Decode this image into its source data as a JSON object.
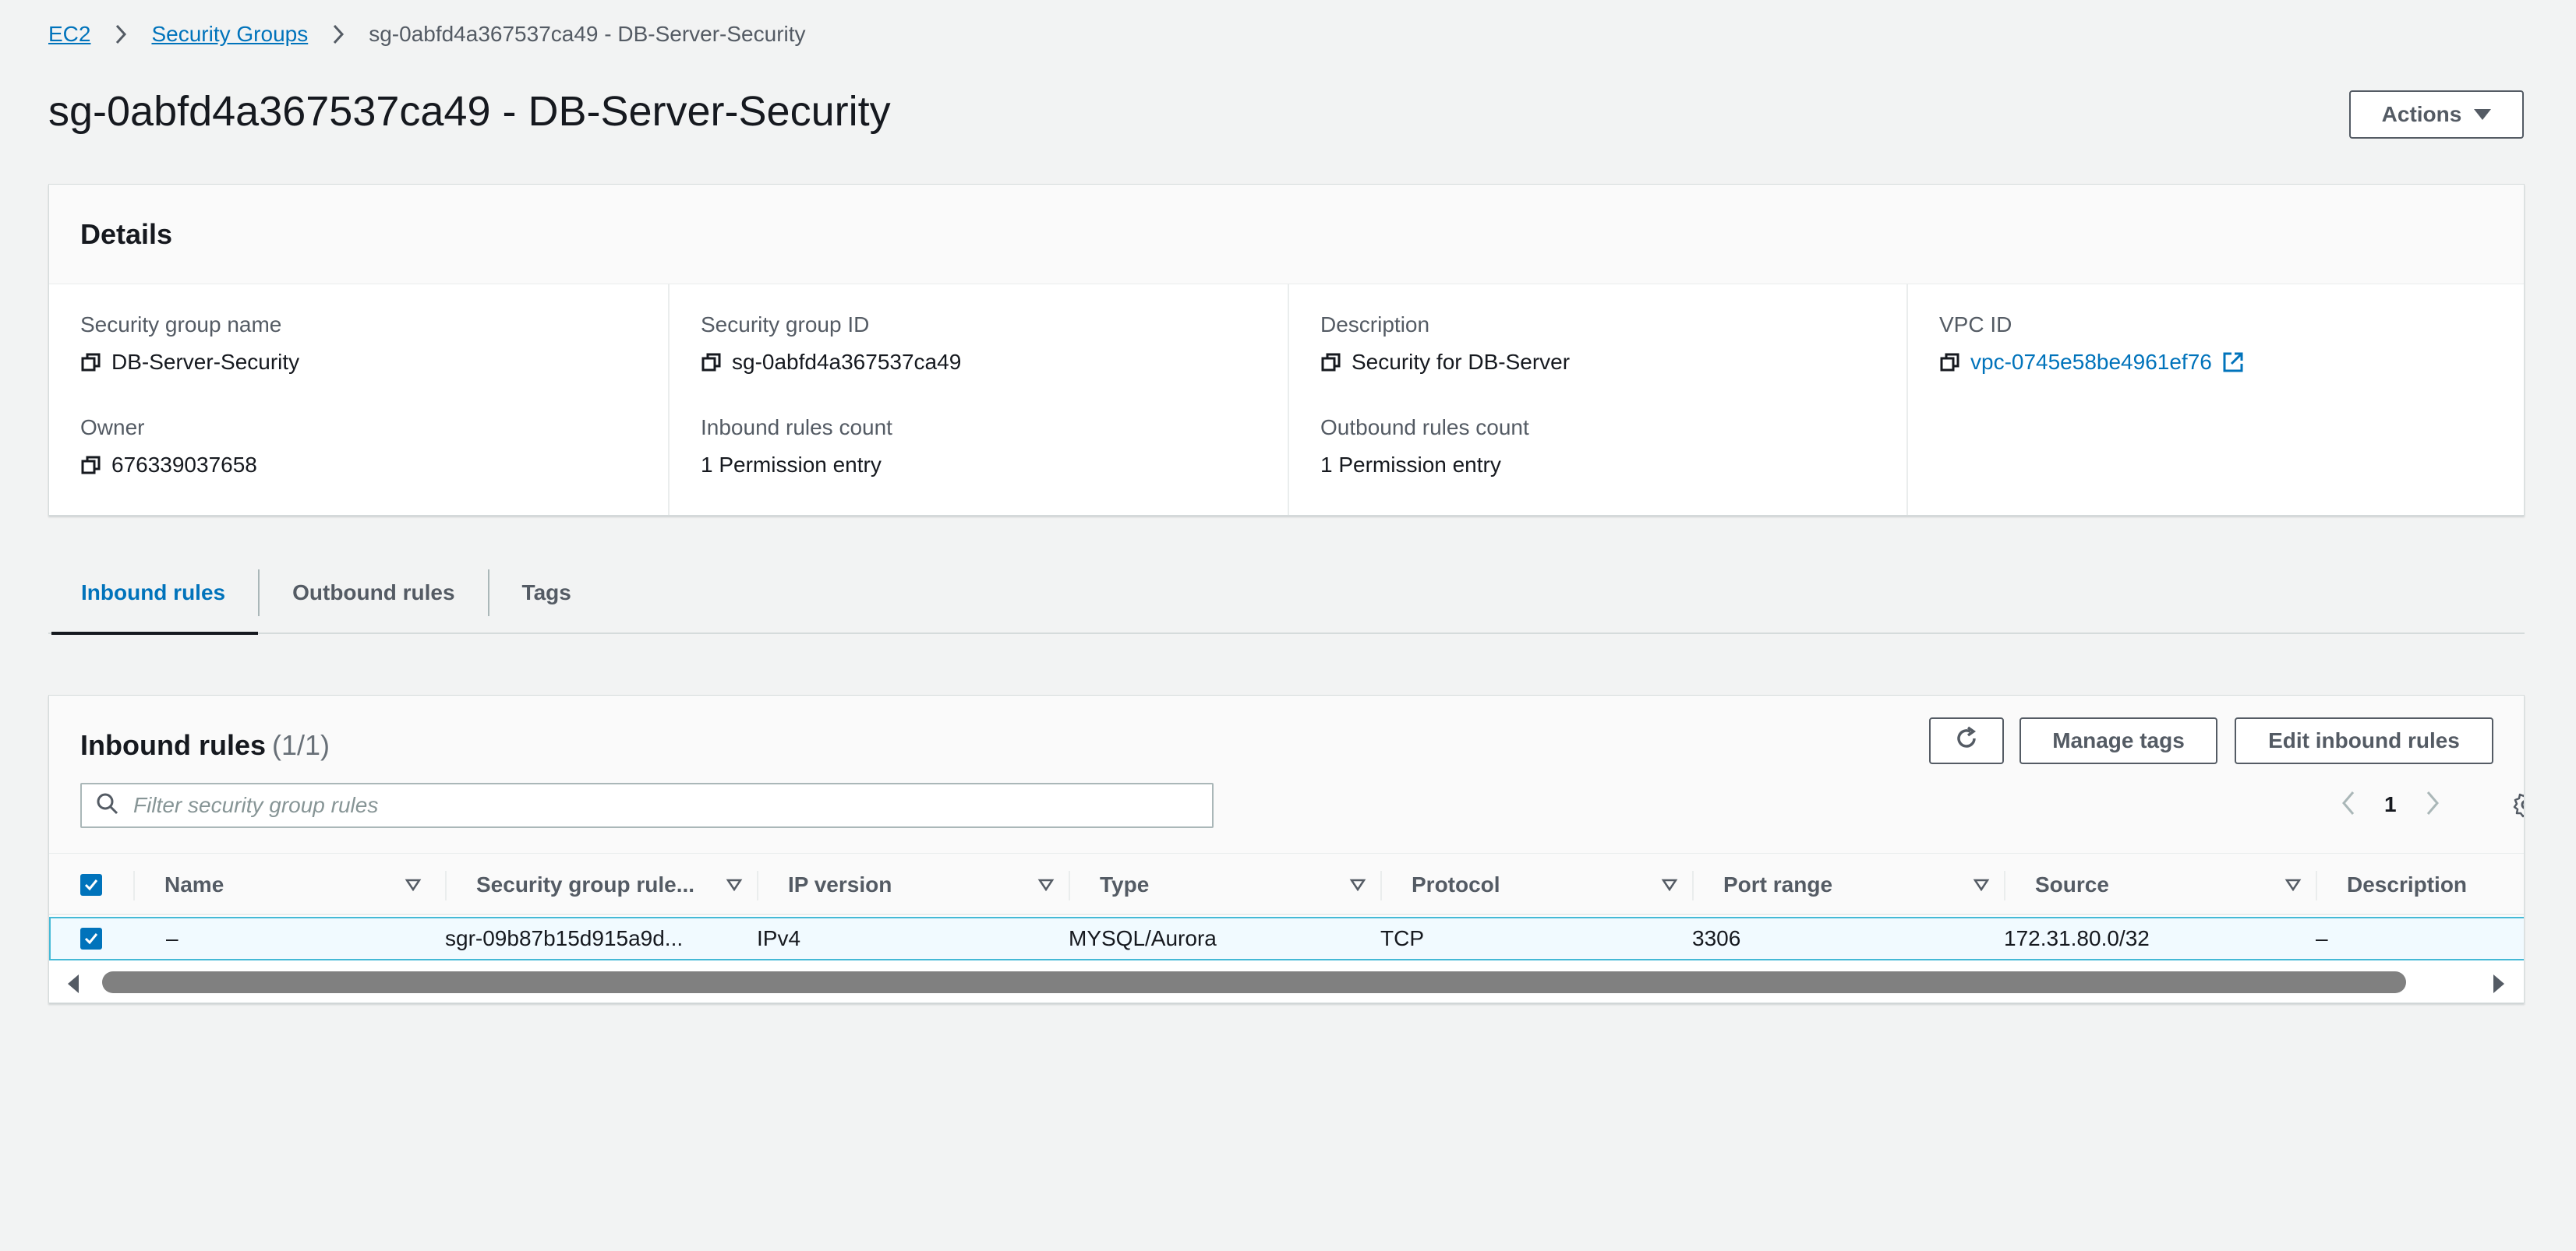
{
  "breadcrumb": {
    "items": [
      "EC2",
      "Security Groups"
    ],
    "current": "sg-0abfd4a367537ca49 - DB-Server-Security"
  },
  "page": {
    "title": "sg-0abfd4a367537ca49 - DB-Server-Security",
    "actions_label": "Actions"
  },
  "details": {
    "heading": "Details",
    "fields": {
      "sg_name": {
        "label": "Security group name",
        "value": "DB-Server-Security"
      },
      "sg_id": {
        "label": "Security group ID",
        "value": "sg-0abfd4a367537ca49"
      },
      "description": {
        "label": "Description",
        "value": "Security for DB-Server"
      },
      "vpc_id": {
        "label": "VPC ID",
        "value": "vpc-0745e58be4961ef76"
      },
      "owner": {
        "label": "Owner",
        "value": "676339037658"
      },
      "inbound_count": {
        "label": "Inbound rules count",
        "value": "1 Permission entry"
      },
      "outbound_count": {
        "label": "Outbound rules count",
        "value": "1 Permission entry"
      }
    }
  },
  "tabs": [
    "Inbound rules",
    "Outbound rules",
    "Tags"
  ],
  "rules": {
    "title": "Inbound rules",
    "count": "(1/1)",
    "manage_tags_label": "Manage tags",
    "edit_label": "Edit inbound rules",
    "filter_placeholder": "Filter security group rules",
    "page_number": "1",
    "columns": [
      "Name",
      "Security group rule...",
      "IP version",
      "Type",
      "Protocol",
      "Port range",
      "Source",
      "Description"
    ],
    "rows": [
      {
        "name": "–",
        "rule_id": "sgr-09b87b15d915a9d...",
        "ip_version": "IPv4",
        "type": "MYSQL/Aurora",
        "protocol": "TCP",
        "port_range": "3306",
        "source": "172.31.80.0/32",
        "description": "–"
      }
    ]
  },
  "colors": {
    "background": "#f2f3f3",
    "link": "#0073bb",
    "selected_row": "#f1faff",
    "selected_border": "#44b9d6",
    "text": "#16191f",
    "muted": "#545b64"
  }
}
